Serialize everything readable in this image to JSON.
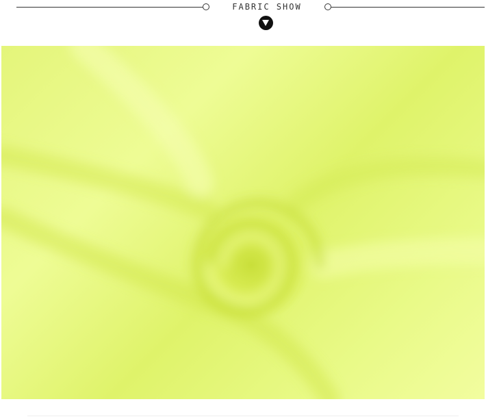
{
  "header": {
    "title": "FABRIC SHOW"
  },
  "photo": {
    "colors": {
      "base": "#e6f77e",
      "shadow": "#c9df3a",
      "highlight": "#f3fda6"
    }
  }
}
